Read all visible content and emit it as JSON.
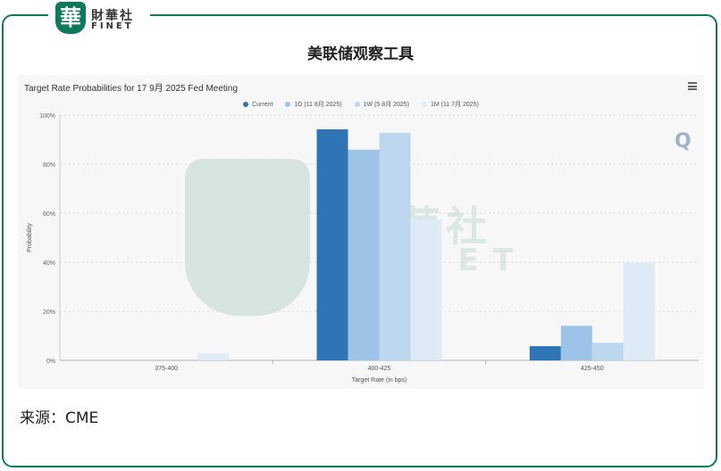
{
  "brand": {
    "seal_char": "華",
    "name_cn": "財華社",
    "name_en": "FINET"
  },
  "page_title": "美联储观察工具",
  "source_label": "来源：CME",
  "chart_data": {
    "type": "bar",
    "title": "Target Rate Probabilities for 17 9月 2025 Fed Meeting",
    "xlabel": "Target Rate (in bps)",
    "ylabel": "Probability",
    "categories": [
      "375-400",
      "400-425",
      "425-450"
    ],
    "ylim": [
      0,
      100
    ],
    "yticks": [
      "0%",
      "20%",
      "40%",
      "60%",
      "80%",
      "100%"
    ],
    "grid": true,
    "legend_position": "top",
    "series": [
      {
        "name": "Current",
        "color": "#2f75b5",
        "values": [
          0,
          94.2,
          5.8
        ]
      },
      {
        "name": "1D (11 8月 2025)",
        "color": "#9dc3e6",
        "values": [
          0,
          85.9,
          14.1
        ]
      },
      {
        "name": "1W (5 8月 2025)",
        "color": "#bdd7ee",
        "values": [
          0,
          92.8,
          7.2
        ]
      },
      {
        "name": "1M (11 7月 2025)",
        "color": "#deebf7",
        "values": [
          2.8,
          57.4,
          39.7
        ]
      }
    ]
  },
  "watermark": {
    "cn": "財華社",
    "en": "FINET",
    "corner_mark": "Q"
  }
}
